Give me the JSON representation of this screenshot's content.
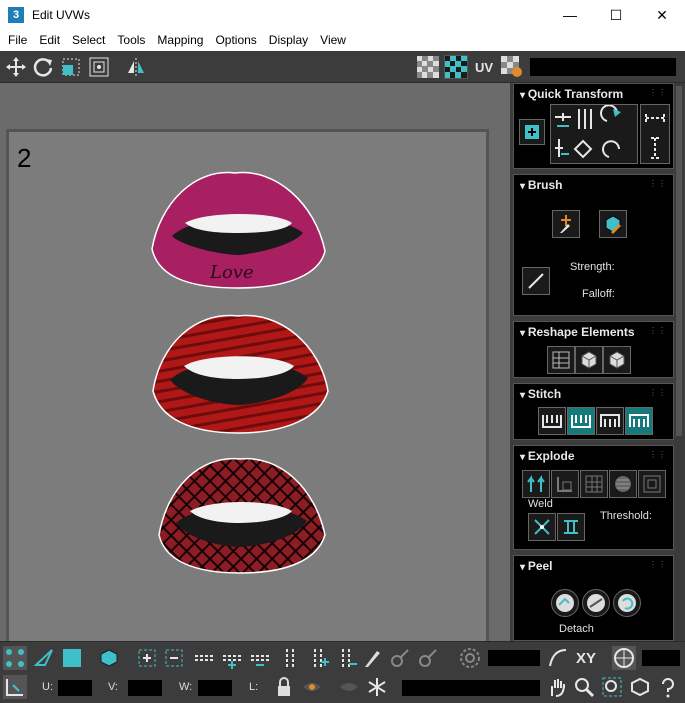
{
  "window": {
    "title": "Edit UVWs",
    "app_icon_letter": "3",
    "minimize": "—",
    "maximize": "☐",
    "close": "✕"
  },
  "menu": [
    "File",
    "Edit",
    "Select",
    "Tools",
    "Mapping",
    "Options",
    "Display",
    "View"
  ],
  "toolbar": {
    "uv_label": "UV"
  },
  "viewport": {
    "tile_number": "2",
    "lip_text": "Love"
  },
  "panel": {
    "quick_transform": {
      "title": "Quick Transform"
    },
    "brush": {
      "title": "Brush",
      "strength_label": "Strength:",
      "falloff_label": "Falloff:"
    },
    "reshape": {
      "title": "Reshape Elements"
    },
    "stitch": {
      "title": "Stitch"
    },
    "explode": {
      "title": "Explode",
      "weld_label": "Weld",
      "threshold_label": "Threshold:"
    },
    "peel": {
      "title": "Peel",
      "detach_label": "Detach"
    }
  },
  "bottom": {
    "xy_label": "XY",
    "u_label": "U:",
    "v_label": "V:",
    "w_label": "W:",
    "l_label": "L:"
  },
  "colors": {
    "accent": "#3fc0c8",
    "panel_bg": "#3c3c3c",
    "viewport_bg": "#6b6b6b",
    "canvas_bg": "#7c7c7c",
    "lips_pink": "#a81f62",
    "lips_red": "#b81c1c"
  }
}
